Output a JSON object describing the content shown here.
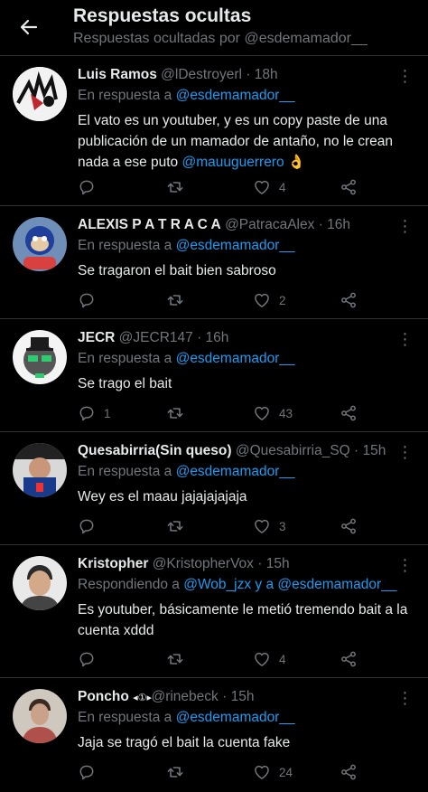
{
  "header": {
    "title": "Respuestas ocultas",
    "subtitle": "Respuestas ocultadas por @esdemamador__"
  },
  "tweets": [
    {
      "name": "Luis Ramos",
      "handle": "@lDestroyerl",
      "time": "18h",
      "reply_prefix": "En respuesta a",
      "reply_target": "@esdemamador__",
      "text_before": "El vato es un youtuber, y es un copy paste de una publicación de un mamador de antaño, no le crean nada a ese puto ",
      "text_mention": "@mauuguerrero",
      "text_after": " 👌",
      "replies": "",
      "retweets": "",
      "likes": "4"
    },
    {
      "name": "ALEXIS P A T R A C A",
      "handle": "@PatracaAlex",
      "time": "16h",
      "reply_prefix": "En respuesta a",
      "reply_target": "@esdemamador__",
      "text": "Se tragaron el bait bien sabroso",
      "replies": "",
      "retweets": "",
      "likes": "2"
    },
    {
      "name": "JECR",
      "handle": "@JECR147",
      "time": "16h",
      "reply_prefix": "En respuesta a",
      "reply_target": "@esdemamador__",
      "text": "Se trago el bait",
      "replies": "1",
      "retweets": "",
      "likes": "43"
    },
    {
      "name": "Quesabirria(Sin queso)",
      "handle": "@Quesabirria_SQ",
      "time": "15h",
      "reply_prefix": "En respuesta a",
      "reply_target": "@esdemamador__",
      "text": "Wey es el maau jajajajajaja",
      "replies": "",
      "retweets": "",
      "likes": "3"
    },
    {
      "name": "Kristopher",
      "handle": "@KristopherVox",
      "time": "15h",
      "reply_prefix": "Respondiendo a",
      "reply_target": "@Wob_jzx y a @esdemamador__",
      "text": "Es youtuber, básicamente le metió tremendo bait a la cuenta xddd",
      "replies": "",
      "retweets": "",
      "likes": "4"
    },
    {
      "name": "Poncho",
      "name_badge": "◂①▸",
      "handle": "@rinebeck",
      "time": "15h",
      "reply_prefix": "En respuesta a",
      "reply_target": "@esdemamador__",
      "text": "Jaja se tragó el bait la cuenta fake",
      "replies": "",
      "retweets": "",
      "likes": "24"
    }
  ],
  "dot": "·",
  "colors": {
    "background": "#000000",
    "text": "#e7e9ea",
    "muted": "#71767b",
    "link": "#1d9bf0",
    "divider": "#2f3336"
  }
}
